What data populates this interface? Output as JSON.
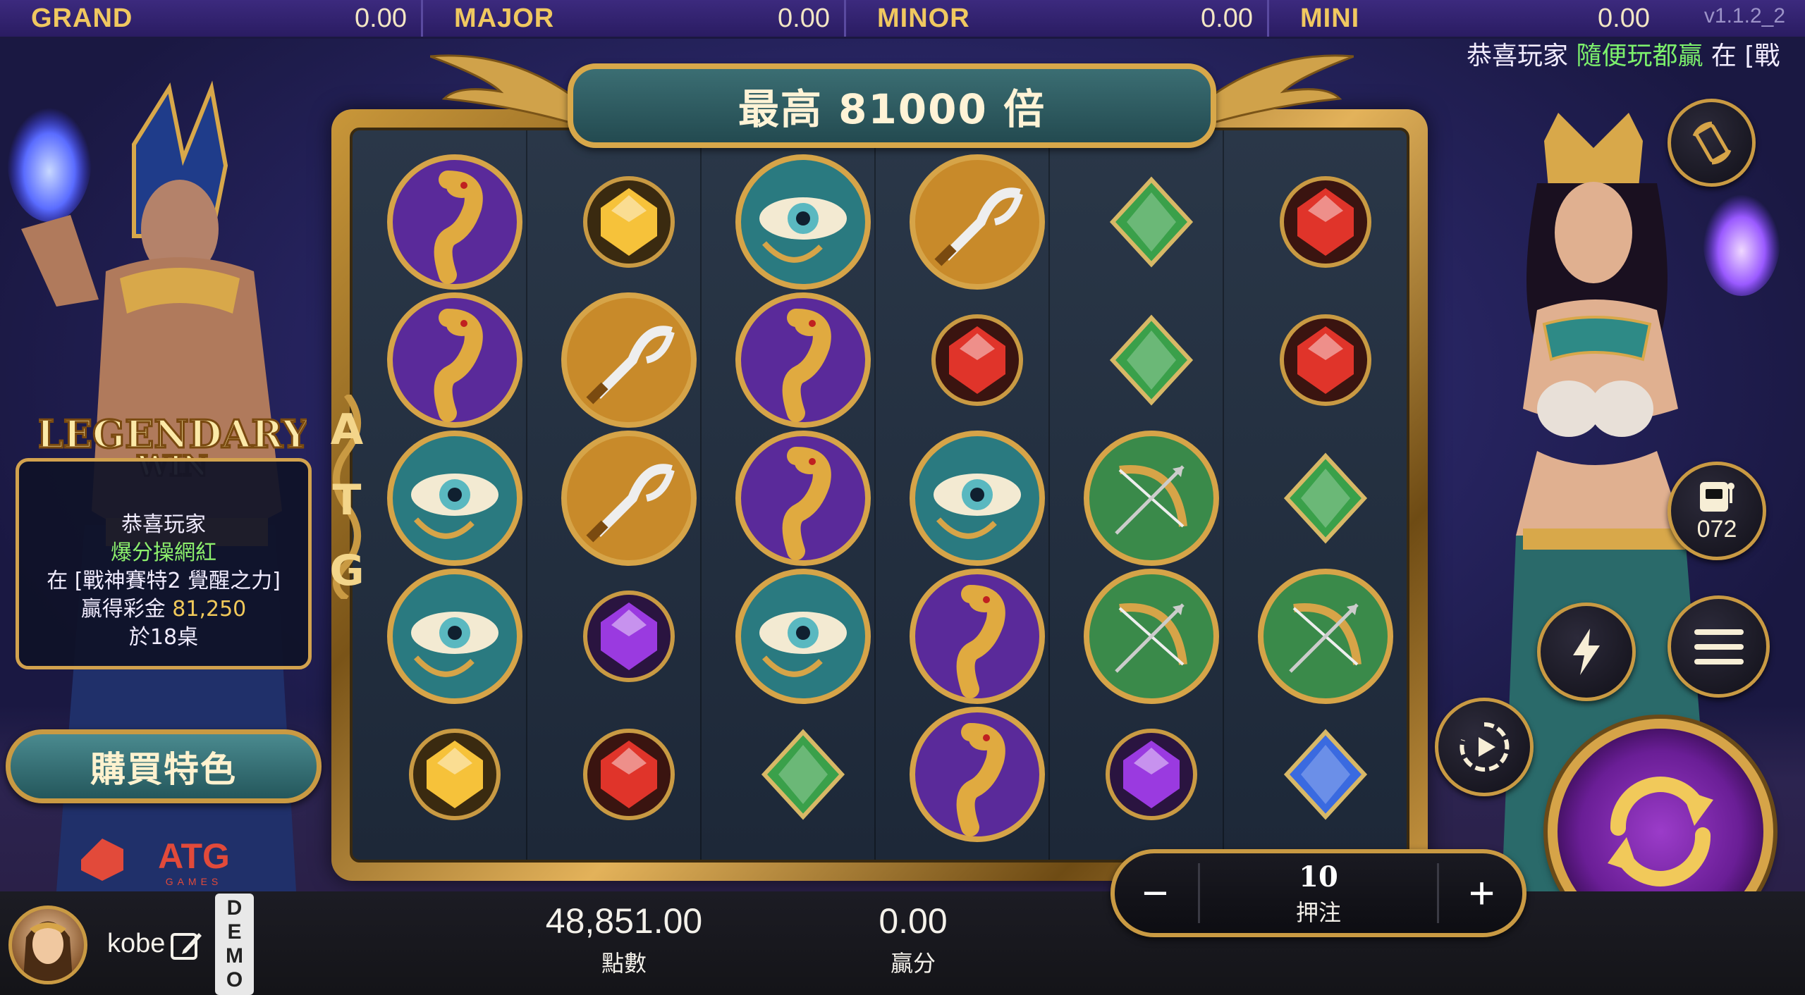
{
  "jackpots": [
    {
      "name": "GRAND",
      "value": "0.00"
    },
    {
      "name": "MAJOR",
      "value": "0.00"
    },
    {
      "name": "MINOR",
      "value": "0.00"
    },
    {
      "name": "MINI",
      "value": "0.00"
    }
  ],
  "version": "v1.1.2_2",
  "marquee": {
    "prefix": "恭喜玩家 ",
    "player": "隨便玩都贏",
    "suffix": " 在 [戰"
  },
  "title": "最高 81000 倍",
  "reel_logo": "ATG",
  "win_panel": {
    "banner": "LEGENDARY WIN",
    "line1": "恭喜玩家",
    "player": "爆分操網紅",
    "game": "在 [戰神賽特2 覺醒之力]",
    "amount_label": "贏得彩金",
    "amount": "81,250",
    "table": "於18桌"
  },
  "buy_feature": "購買特色",
  "brand": {
    "name": "ATG",
    "sub": "GAMES"
  },
  "counter": "072",
  "user": {
    "name": "kobe",
    "mode": [
      "D",
      "E",
      "M",
      "O"
    ]
  },
  "balance": {
    "value": "48,851.00",
    "label": "點數"
  },
  "win": {
    "value": "0.00",
    "label": "贏分"
  },
  "bet": {
    "value": "10",
    "label": "押注",
    "minus": "−",
    "plus": "+"
  },
  "grid": [
    [
      "cobra",
      "gold-gem",
      "eye",
      "khopesh",
      "green-gem",
      "red-gem"
    ],
    [
      "cobra",
      "khopesh",
      "cobra",
      "red-gem",
      "green-gem",
      "red-gem"
    ],
    [
      "eye",
      "khopesh",
      "cobra",
      "eye",
      "bow",
      "green-gem"
    ],
    [
      "eye",
      "purple-gem",
      "eye",
      "cobra",
      "bow",
      "bow"
    ],
    [
      "gold-gem",
      "red-gem",
      "green-gem",
      "cobra",
      "purple-gem",
      "blue-gem"
    ]
  ],
  "colors": {
    "gold": "#d6a448",
    "jackpot_text": "#f0c860",
    "highlight_green": "#8df06c",
    "highlight_yellow": "#f1c95a",
    "spin_purple": "#7a2aa8"
  }
}
